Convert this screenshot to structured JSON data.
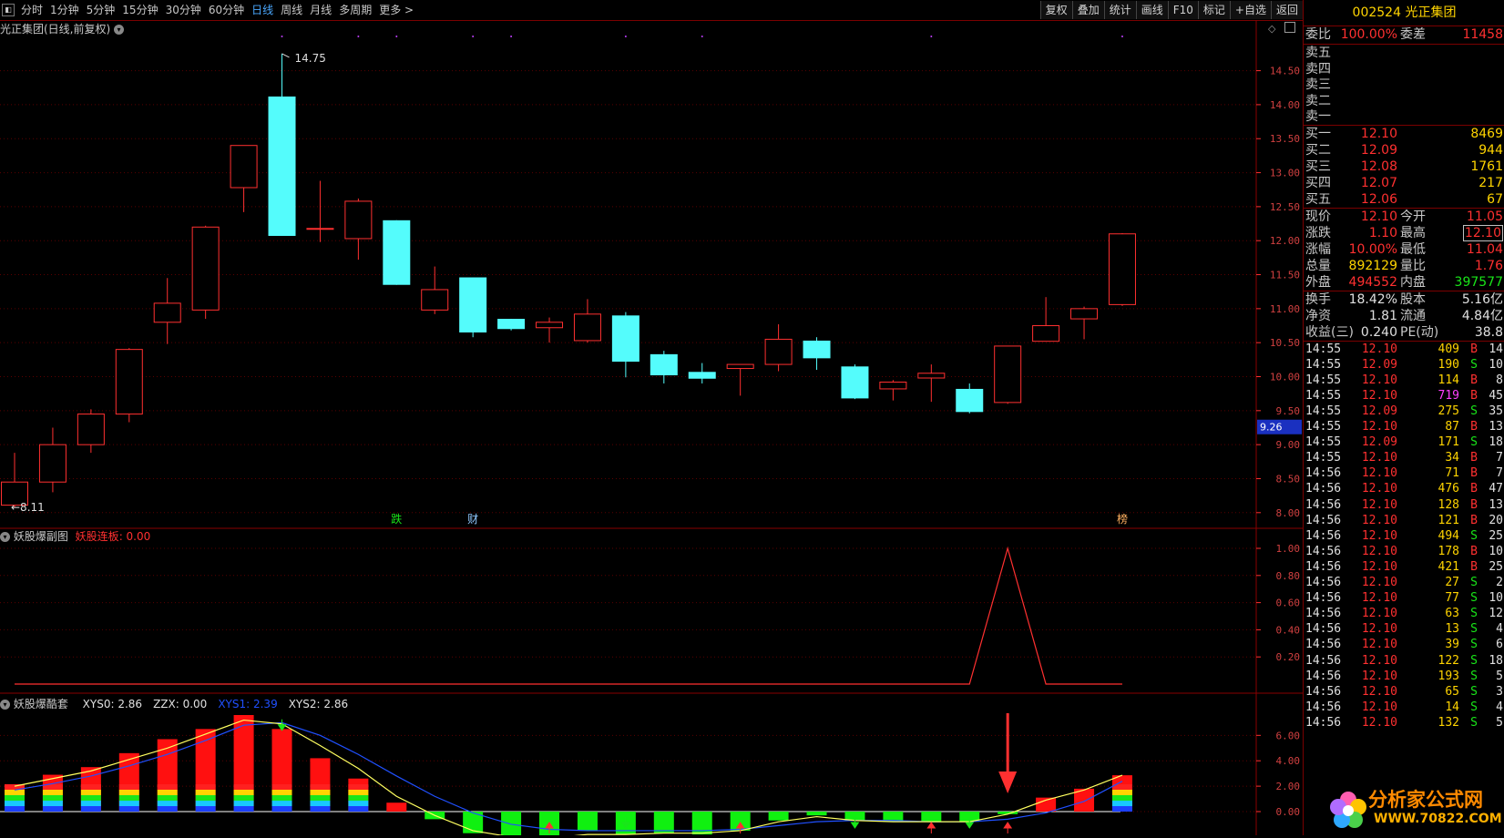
{
  "toolbar": {
    "periods": [
      {
        "label": "分时",
        "active": false
      },
      {
        "label": "1分钟",
        "active": false
      },
      {
        "label": "5分钟",
        "active": false
      },
      {
        "label": "15分钟",
        "active": false
      },
      {
        "label": "30分钟",
        "active": false
      },
      {
        "label": "60分钟",
        "active": false
      },
      {
        "label": "日线",
        "active": true
      },
      {
        "label": "周线",
        "active": false
      },
      {
        "label": "月线",
        "active": false
      },
      {
        "label": "多周期",
        "active": false
      },
      {
        "label": "更多 >",
        "active": false
      }
    ],
    "buttons": [
      "复权",
      "叠加",
      "统计",
      "画线",
      "F10",
      "标记",
      "+自选",
      "返回"
    ]
  },
  "main_chart": {
    "title": "光正集团(日线,前复权)",
    "high_label": "14.75",
    "low_label": "8.11",
    "price_tag": "9.26",
    "markers": [
      {
        "text": "跌",
        "candle_index": 10
      },
      {
        "text": "财",
        "candle_index": 12
      },
      {
        "text": "榜",
        "candle_index": 29
      }
    ]
  },
  "sub1": {
    "name": "妖股爆副图",
    "series_label": "妖股连板",
    "series_value": "0.00",
    "ticks": [
      "1.00",
      "0.80",
      "0.60",
      "0.40",
      "0.20"
    ]
  },
  "sub2": {
    "name": "妖股爆酷套",
    "legend": [
      {
        "name": "XYS0",
        "value": "2.86",
        "color": "#e0e0e0"
      },
      {
        "name": "ZZX",
        "value": "0.00",
        "color": "#e0e0e0"
      },
      {
        "name": "XYS1",
        "value": "2.39",
        "color": "#2050ff"
      },
      {
        "name": "XYS2",
        "value": "2.86",
        "color": "#e0e0e0"
      }
    ],
    "ticks": [
      "6.00",
      "4.00",
      "2.00",
      "0.00"
    ]
  },
  "chart_data": [
    {
      "type": "candlestick",
      "title": "光正集团(日线,前复权)",
      "ylim": [
        7.85,
        14.95
      ],
      "y_ticks": [
        14.5,
        14.0,
        13.5,
        13.0,
        12.5,
        12.0,
        11.5,
        11.0,
        10.5,
        10.0,
        9.5,
        9.0,
        8.5,
        8.0
      ],
      "candles": [
        {
          "o": 8.11,
          "h": 8.88,
          "l": 8.08,
          "c": 8.45
        },
        {
          "o": 8.45,
          "h": 9.25,
          "l": 8.3,
          "c": 9.0
        },
        {
          "o": 9.0,
          "h": 9.52,
          "l": 8.88,
          "c": 9.45
        },
        {
          "o": 9.45,
          "h": 10.42,
          "l": 9.33,
          "c": 10.4
        },
        {
          "o": 10.8,
          "h": 11.45,
          "l": 10.48,
          "c": 11.08
        },
        {
          "o": 10.98,
          "h": 12.22,
          "l": 10.85,
          "c": 12.2
        },
        {
          "o": 12.78,
          "h": 13.4,
          "l": 12.42,
          "c": 13.4
        },
        {
          "o": 14.12,
          "h": 14.75,
          "l": 12.07,
          "c": 12.07
        },
        {
          "o": 12.18,
          "h": 12.88,
          "l": 11.98,
          "c": 12.18
        },
        {
          "o": 12.03,
          "h": 12.62,
          "l": 11.72,
          "c": 12.58
        },
        {
          "o": 12.3,
          "h": 12.3,
          "l": 11.35,
          "c": 11.35
        },
        {
          "o": 10.98,
          "h": 11.62,
          "l": 10.92,
          "c": 11.28
        },
        {
          "o": 11.46,
          "h": 11.46,
          "l": 10.58,
          "c": 10.65
        },
        {
          "o": 10.85,
          "h": 10.85,
          "l": 10.68,
          "c": 10.7
        },
        {
          "o": 10.72,
          "h": 10.87,
          "l": 10.5,
          "c": 10.8
        },
        {
          "o": 10.53,
          "h": 11.14,
          "l": 10.5,
          "c": 10.92
        },
        {
          "o": 10.9,
          "h": 10.95,
          "l": 9.99,
          "c": 10.22
        },
        {
          "o": 10.33,
          "h": 10.38,
          "l": 9.9,
          "c": 10.02
        },
        {
          "o": 10.07,
          "h": 10.2,
          "l": 9.9,
          "c": 9.97
        },
        {
          "o": 10.12,
          "h": 10.15,
          "l": 9.72,
          "c": 10.18
        },
        {
          "o": 10.18,
          "h": 10.77,
          "l": 10.08,
          "c": 10.55
        },
        {
          "o": 10.53,
          "h": 10.58,
          "l": 10.1,
          "c": 10.27
        },
        {
          "o": 10.15,
          "h": 10.18,
          "l": 9.67,
          "c": 9.68
        },
        {
          "o": 9.82,
          "h": 9.95,
          "l": 9.65,
          "c": 9.92
        },
        {
          "o": 9.98,
          "h": 10.18,
          "l": 9.63,
          "c": 10.05
        },
        {
          "o": 9.82,
          "h": 9.9,
          "l": 9.46,
          "c": 9.48
        },
        {
          "o": 9.62,
          "h": 10.45,
          "l": 9.6,
          "c": 10.45
        },
        {
          "o": 10.52,
          "h": 11.17,
          "l": 10.52,
          "c": 10.75
        },
        {
          "o": 10.85,
          "h": 11.03,
          "l": 10.55,
          "c": 11.0
        },
        {
          "o": 11.06,
          "h": 12.11,
          "l": 11.04,
          "c": 12.1
        }
      ]
    },
    {
      "type": "line",
      "title": "妖股爆副图",
      "series": [
        {
          "name": "妖股连板",
          "values": [
            0,
            0,
            0,
            0,
            0,
            0,
            0,
            0,
            0,
            0,
            0,
            0,
            0,
            0,
            0,
            0,
            0,
            0,
            0,
            0,
            0,
            0,
            0,
            0,
            0,
            0,
            1,
            0,
            0,
            0
          ]
        }
      ],
      "ylim": [
        0,
        1.0
      ]
    },
    {
      "type": "bar",
      "title": "妖股爆酷套",
      "series": [
        {
          "name": "XYS0",
          "values": [
            2.1,
            2.9,
            3.5,
            4.6,
            5.7,
            6.5,
            7.6,
            6.5,
            4.2,
            2.6,
            0.7,
            -0.6,
            -1.7,
            -2.1,
            -2.1,
            -1.5,
            -1.8,
            -1.7,
            -1.8,
            -1.5,
            -0.7,
            -0.3,
            -0.7,
            -0.8,
            -0.8,
            -0.8,
            -0.2,
            1.1,
            1.8,
            2.86
          ]
        },
        {
          "name": "XYS1",
          "values": [
            1.7,
            2.2,
            2.8,
            3.6,
            4.5,
            5.6,
            6.8,
            7.0,
            6.0,
            4.5,
            2.8,
            1.2,
            -0.1,
            -1.0,
            -1.4,
            -1.5,
            -1.5,
            -1.5,
            -1.5,
            -1.4,
            -1.1,
            -0.8,
            -0.7,
            -0.7,
            -0.8,
            -0.8,
            -0.6,
            -0.1,
            0.8,
            2.39
          ]
        },
        {
          "name": "XYS2",
          "values": [
            2.0,
            2.6,
            3.2,
            4.1,
            5.0,
            6.1,
            7.2,
            6.9,
            5.2,
            3.4,
            1.2,
            -0.3,
            -1.5,
            -2.0,
            -2.1,
            -1.8,
            -1.8,
            -1.7,
            -1.7,
            -1.5,
            -0.8,
            -0.4,
            -0.7,
            -0.8,
            -0.8,
            -0.8,
            -0.2,
            0.9,
            1.7,
            2.86
          ]
        }
      ],
      "ylim": [
        -2.4,
        8.0
      ],
      "arrows": [
        {
          "candle_index": 7,
          "dir": "down",
          "color": "green",
          "pos": "top"
        },
        {
          "candle_index": 14,
          "dir": "up",
          "color": "red",
          "pos": "bottom"
        },
        {
          "candle_index": 16,
          "dir": "down",
          "color": "green",
          "pos": "bottom"
        },
        {
          "candle_index": 19,
          "dir": "up",
          "color": "red",
          "pos": "bottom"
        },
        {
          "candle_index": 22,
          "dir": "down",
          "color": "green",
          "pos": "bottom"
        },
        {
          "candle_index": 24,
          "dir": "up",
          "color": "red",
          "pos": "bottom"
        },
        {
          "candle_index": 25,
          "dir": "down",
          "color": "green",
          "pos": "bottom"
        },
        {
          "candle_index": 26,
          "dir": "up",
          "color": "red",
          "pos": "bottom"
        }
      ]
    }
  ],
  "quote": {
    "code": "002524",
    "name": "光正集团",
    "weibi_label": "委比",
    "weibi_value": "100.00%",
    "weicha_label": "委差",
    "weicha_value": "11458",
    "sell": [
      {
        "label": "卖五",
        "price": "",
        "vol": ""
      },
      {
        "label": "卖四",
        "price": "",
        "vol": ""
      },
      {
        "label": "卖三",
        "price": "",
        "vol": ""
      },
      {
        "label": "卖二",
        "price": "",
        "vol": ""
      },
      {
        "label": "卖一",
        "price": "",
        "vol": ""
      }
    ],
    "buy": [
      {
        "label": "买一",
        "price": "12.10",
        "vol": "8469"
      },
      {
        "label": "买二",
        "price": "12.09",
        "vol": "944"
      },
      {
        "label": "买三",
        "price": "12.08",
        "vol": "1761"
      },
      {
        "label": "买四",
        "price": "12.07",
        "vol": "217"
      },
      {
        "label": "买五",
        "price": "12.06",
        "vol": "67"
      }
    ],
    "stats": [
      {
        "l1": "现价",
        "v1": "12.10",
        "c1": "red",
        "l2": "今开",
        "v2": "11.05",
        "c2": "red"
      },
      {
        "l1": "涨跌",
        "v1": "1.10",
        "c1": "red",
        "l2": "最高",
        "v2": "12.10",
        "c2": "red",
        "box2": true
      },
      {
        "l1": "涨幅",
        "v1": "10.00%",
        "c1": "red",
        "l2": "最低",
        "v2": "11.04",
        "c2": "red"
      },
      {
        "l1": "总量",
        "v1": "892129",
        "c1": "yel",
        "l2": "量比",
        "v2": "1.76",
        "c2": "red"
      },
      {
        "l1": "外盘",
        "v1": "494552",
        "c1": "red",
        "l2": "内盘",
        "v2": "397577",
        "c2": "green"
      }
    ],
    "stats2": [
      {
        "l1": "换手",
        "v1": "18.42%",
        "c1": "white",
        "l2": "股本",
        "v2": "5.16亿",
        "c2": "white"
      },
      {
        "l1": "净资",
        "v1": "1.81",
        "c1": "white",
        "l2": "流通",
        "v2": "4.84亿",
        "c2": "white"
      },
      {
        "l1": "收益(三)",
        "v1": "0.240",
        "c1": "white",
        "l2": "PE(动)",
        "v2": "38.8",
        "c2": "white"
      }
    ],
    "trades": [
      {
        "t": "14:55",
        "p": "12.10",
        "v": "409",
        "s": "B",
        "n": "14"
      },
      {
        "t": "14:55",
        "p": "12.09",
        "v": "190",
        "s": "S",
        "n": "10"
      },
      {
        "t": "14:55",
        "p": "12.10",
        "v": "114",
        "s": "B",
        "n": "8"
      },
      {
        "t": "14:55",
        "p": "12.10",
        "v": "719",
        "s": "B",
        "n": "45",
        "mag": true
      },
      {
        "t": "14:55",
        "p": "12.09",
        "v": "275",
        "s": "S",
        "n": "35"
      },
      {
        "t": "14:55",
        "p": "12.10",
        "v": "87",
        "s": "B",
        "n": "13"
      },
      {
        "t": "14:55",
        "p": "12.09",
        "v": "171",
        "s": "S",
        "n": "18"
      },
      {
        "t": "14:55",
        "p": "12.10",
        "v": "34",
        "s": "B",
        "n": "7"
      },
      {
        "t": "14:56",
        "p": "12.10",
        "v": "71",
        "s": "B",
        "n": "7"
      },
      {
        "t": "14:56",
        "p": "12.10",
        "v": "476",
        "s": "B",
        "n": "47"
      },
      {
        "t": "14:56",
        "p": "12.10",
        "v": "128",
        "s": "B",
        "n": "13"
      },
      {
        "t": "14:56",
        "p": "12.10",
        "v": "121",
        "s": "B",
        "n": "20"
      },
      {
        "t": "14:56",
        "p": "12.10",
        "v": "494",
        "s": "S",
        "n": "25"
      },
      {
        "t": "14:56",
        "p": "12.10",
        "v": "178",
        "s": "B",
        "n": "10"
      },
      {
        "t": "14:56",
        "p": "12.10",
        "v": "421",
        "s": "B",
        "n": "25"
      },
      {
        "t": "14:56",
        "p": "12.10",
        "v": "27",
        "s": "S",
        "n": "2"
      },
      {
        "t": "14:56",
        "p": "12.10",
        "v": "77",
        "s": "S",
        "n": "10"
      },
      {
        "t": "14:56",
        "p": "12.10",
        "v": "63",
        "s": "S",
        "n": "12"
      },
      {
        "t": "14:56",
        "p": "12.10",
        "v": "13",
        "s": "S",
        "n": "4"
      },
      {
        "t": "14:56",
        "p": "12.10",
        "v": "39",
        "s": "S",
        "n": "6"
      },
      {
        "t": "14:56",
        "p": "12.10",
        "v": "122",
        "s": "S",
        "n": "18"
      },
      {
        "t": "14:56",
        "p": "12.10",
        "v": "193",
        "s": "S",
        "n": "5"
      },
      {
        "t": "14:56",
        "p": "12.10",
        "v": "65",
        "s": "S",
        "n": "3"
      },
      {
        "t": "14:56",
        "p": "12.10",
        "v": "14",
        "s": "S",
        "n": "4"
      },
      {
        "t": "14:56",
        "p": "12.10",
        "v": "132",
        "s": "S",
        "n": "5"
      }
    ]
  },
  "watermark": {
    "brand": "分析家公式网",
    "url": "WWW.70822.COM"
  }
}
